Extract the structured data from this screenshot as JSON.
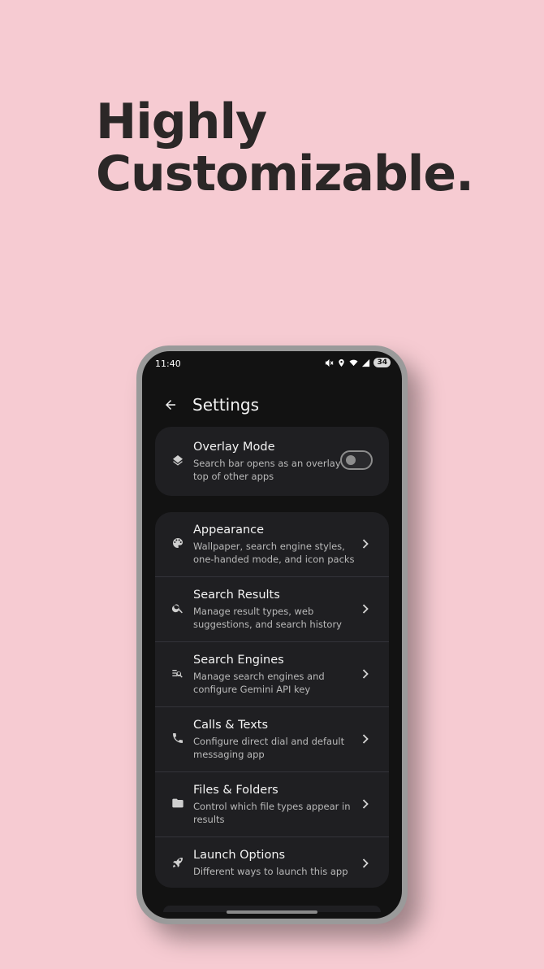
{
  "headline": {
    "line1": "Highly",
    "line2": "Customizable."
  },
  "status_bar": {
    "time": "11:40",
    "battery": "34",
    "icons": [
      "mute-icon",
      "location-icon",
      "wifi-icon",
      "signal-icon",
      "battery-icon"
    ]
  },
  "app_bar": {
    "title": "Settings",
    "back_icon": "arrow-left-icon"
  },
  "overlay_card": {
    "title": "Overlay Mode",
    "subtitle": "Search bar opens as an overlay on top of other apps",
    "icon": "layers-icon",
    "toggle_on": false
  },
  "settings_list": [
    {
      "title": "Appearance",
      "subtitle": "Wallpaper, search engine styles, one-handed mode, and icon packs",
      "icon": "palette-icon"
    },
    {
      "title": "Search Results",
      "subtitle": "Manage result types, web suggestions, and search history",
      "icon": "search-icon"
    },
    {
      "title": "Search Engines",
      "subtitle": "Manage search engines and configure Gemini API key",
      "icon": "manage-search-icon"
    },
    {
      "title": "Calls & Texts",
      "subtitle": "Configure direct dial and default messaging app",
      "icon": "phone-icon"
    },
    {
      "title": "Files & Folders",
      "subtitle": "Control which file types appear in results",
      "icon": "folder-icon"
    },
    {
      "title": "Launch Options",
      "subtitle": "Different ways to launch this app",
      "icon": "rocket-icon"
    }
  ],
  "colors": {
    "background": "#f6cbd2",
    "headline": "#2b2727",
    "screen": "#121212",
    "card": "#1f1f22"
  }
}
